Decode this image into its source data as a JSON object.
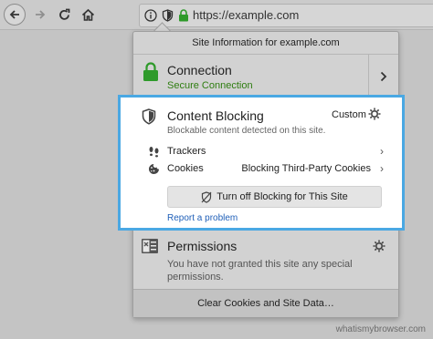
{
  "toolbar": {
    "icons": {
      "back": "back-arrow-icon",
      "forward": "forward-arrow-icon",
      "reload": "reload-icon",
      "home": "home-icon"
    },
    "url": "https://example.com"
  },
  "panel": {
    "header": "Site Information for example.com",
    "connection": {
      "title": "Connection",
      "subtitle": "Secure Connection",
      "subtitle_color": "#2e7d10"
    },
    "content_blocking": {
      "title": "Content Blocking",
      "mode": "Custom",
      "subtitle": "Blockable content detected on this site.",
      "rows": [
        {
          "label": "Trackers",
          "value": ""
        },
        {
          "label": "Cookies",
          "value": "Blocking Third-Party Cookies"
        }
      ],
      "turn_off_button": "Turn off Blocking for This Site",
      "report_link": "Report a problem",
      "highlight_color": "#4aa8e3"
    },
    "permissions": {
      "title": "Permissions",
      "description": "You have not granted this site any special permissions."
    },
    "footer_button": "Clear Cookies and Site Data…"
  },
  "watermark": "whatismybrowser.com"
}
